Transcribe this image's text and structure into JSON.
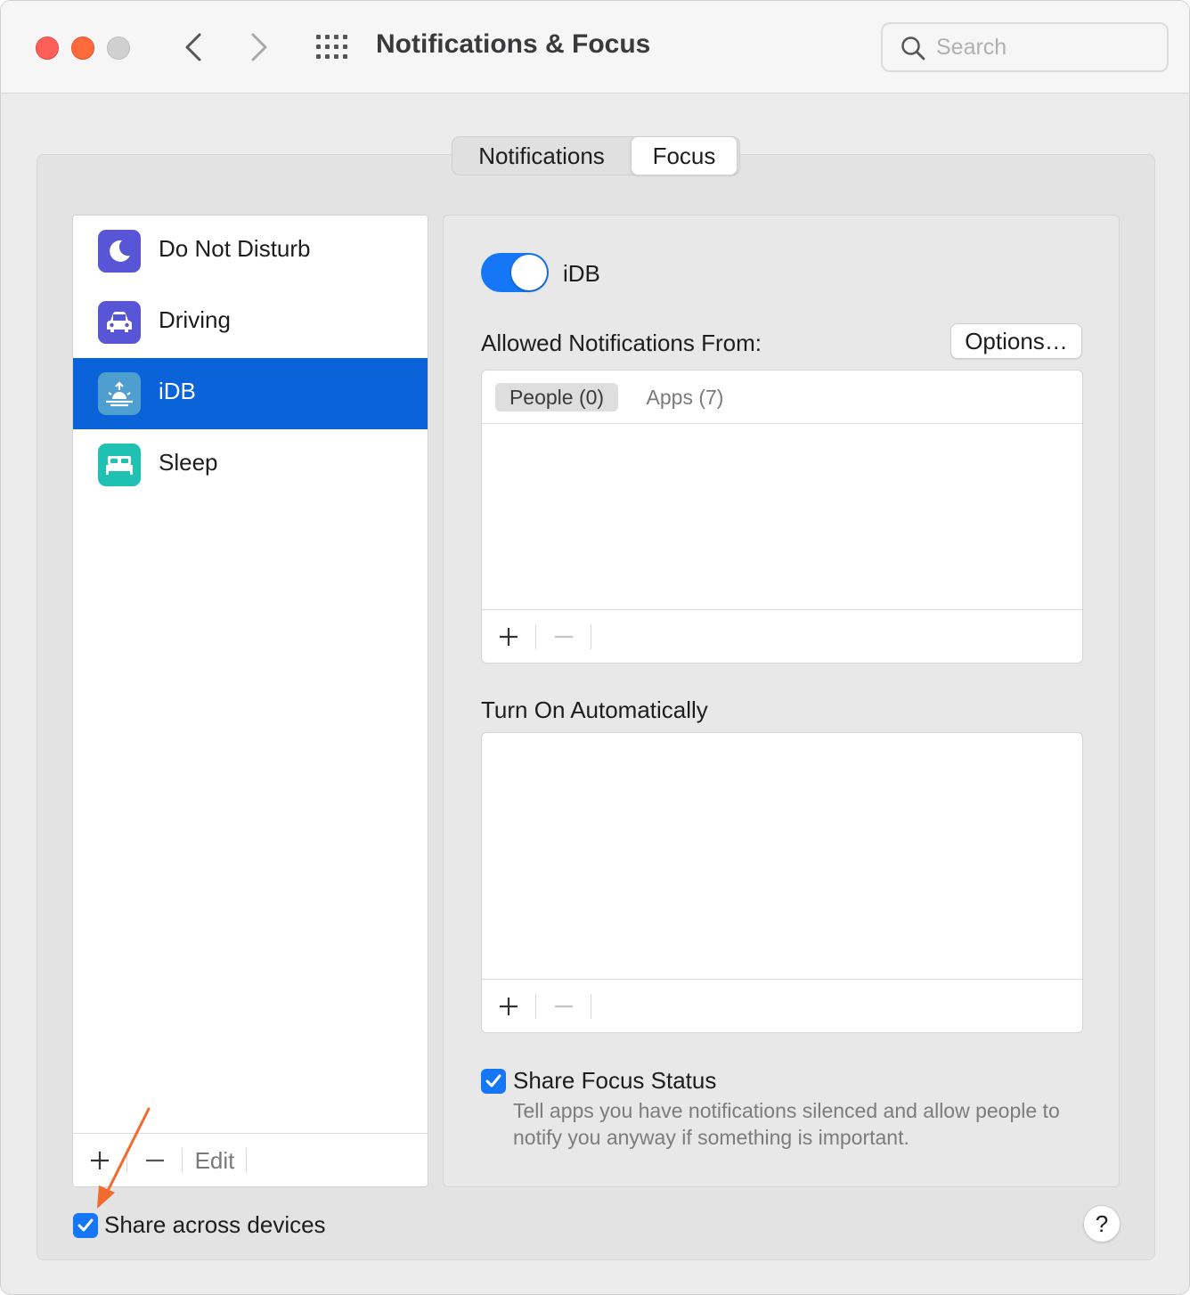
{
  "window": {
    "title": "Notifications & Focus",
    "search_placeholder": "Search"
  },
  "tabs": [
    {
      "label": "Notifications",
      "selected": false
    },
    {
      "label": "Focus",
      "selected": true
    }
  ],
  "sidebar": {
    "items": [
      {
        "label": "Do Not Disturb",
        "icon": "moon-icon",
        "color": "#5856d6"
      },
      {
        "label": "Driving",
        "icon": "car-icon",
        "color": "#5856d6"
      },
      {
        "label": "iDB",
        "icon": "sunrise-icon",
        "color": "#4f9ed0",
        "selected": true
      },
      {
        "label": "Sleep",
        "icon": "bed-icon",
        "color": "#1fc2b2"
      }
    ],
    "footer": {
      "add": "+",
      "remove": "—",
      "edit": "Edit"
    }
  },
  "detail": {
    "focus_name": "iDB",
    "toggle_on": true,
    "allowed_label": "Allowed Notifications From:",
    "options_label": "Options…",
    "allowed_tabs": [
      {
        "label": "People (0)",
        "selected": true
      },
      {
        "label": "Apps (7)",
        "selected": false
      }
    ],
    "turn_on_label": "Turn On Automatically",
    "share_status": {
      "checked": true,
      "label": "Share Focus Status",
      "description": "Tell apps you have notifications silenced and allow people to notify you anyway if something is important."
    }
  },
  "share_devices": {
    "checked": true,
    "label": "Share across devices"
  },
  "help_label": "?",
  "colors": {
    "accent": "#1577f5",
    "selection": "#0a63d9",
    "annotation_arrow": "#f26a2e"
  }
}
